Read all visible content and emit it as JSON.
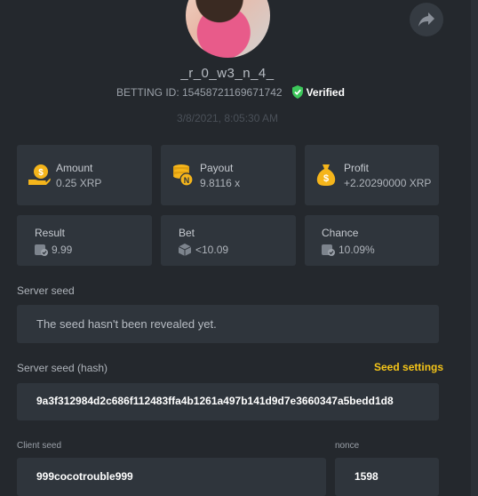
{
  "profile": {
    "username": "_r_0_w3_n_4_",
    "betting_id": "BETTING ID: 15458721169671742",
    "verified": "Verified",
    "timestamp": "3/8/2021, 8:05:30 AM"
  },
  "stats": {
    "amount": {
      "label": "Amount",
      "value": "0.25 XRP"
    },
    "payout": {
      "label": "Payout",
      "value": "9.8116 x"
    },
    "profit": {
      "label": "Profit",
      "value": "+2.20290000 XRP"
    },
    "result": {
      "label": "Result",
      "value": "9.99"
    },
    "bet": {
      "label": "Bet",
      "value": "<10.09"
    },
    "chance": {
      "label": "Chance",
      "value": "10.09%"
    }
  },
  "seeds": {
    "server_seed_label": "Server seed",
    "server_seed_value": "The seed hasn't been revealed yet.",
    "server_hash_label": "Server seed (hash)",
    "seed_settings": "Seed settings",
    "server_hash_value": "9a3f312984d2c686f112483ffa4b1261a497b141d9d7e3660347a5bedd1d8",
    "client_seed_label": "Client seed",
    "client_seed_value": "999cocotrouble999",
    "nonce_label": "nonce",
    "nonce_value": "1598"
  },
  "colors": {
    "background": "#24282d",
    "card": "#2f353c",
    "accent_gold": "#f5c518",
    "verified_green": "#3cc75a"
  }
}
